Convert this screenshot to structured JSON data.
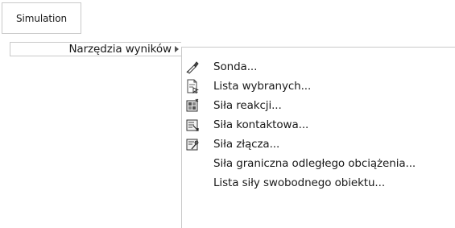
{
  "menubar": {
    "simulation_label": "Simulation"
  },
  "submenu_l1": {
    "result_tools_label": "Narzędzia wyników",
    "arrow_icon": "submenu-arrow-icon"
  },
  "submenu_l2": {
    "items": [
      {
        "label": "Sonda...",
        "icon": "probe-icon"
      },
      {
        "label": "Lista wybranych...",
        "icon": "selected-list-icon"
      },
      {
        "label": "Siła reakcji...",
        "icon": "reaction-force-icon"
      },
      {
        "label": "Siła kontaktowa...",
        "icon": "contact-force-icon"
      },
      {
        "label": "Siła złącza...",
        "icon": "connector-force-icon"
      },
      {
        "label": "Siła graniczna odległego obciążenia...",
        "icon": ""
      },
      {
        "label": "Lista siły swobodnego obiektu...",
        "icon": ""
      }
    ]
  }
}
